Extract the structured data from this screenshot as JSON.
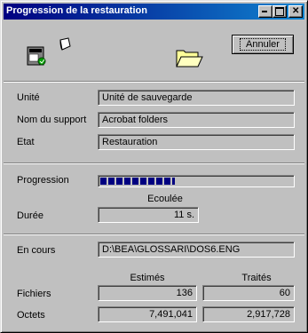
{
  "window": {
    "title": "Progression de la restauration",
    "cancel_label": "Annuler"
  },
  "info": {
    "unite_label": "Unité",
    "unite_value": "Unité de sauvegarde",
    "support_label": "Nom du support",
    "support_value": "Acrobat folders",
    "etat_label": "Etat",
    "etat_value": "Restauration"
  },
  "progress": {
    "label": "Progression",
    "fraction": 0.39,
    "elapsed_header": "Ecoulée",
    "duration_label": "Durée",
    "duration_value": "11 s."
  },
  "current": {
    "label": "En cours",
    "path": "D:\\BEA\\GLOSSARI\\DOS6.ENG",
    "estimated_header": "Estimés",
    "processed_header": "Traités",
    "files_label": "Fichiers",
    "files_estimated": "136",
    "files_processed": "60",
    "bytes_label": "Octets",
    "bytes_estimated": "7,491,041",
    "bytes_processed": "2,917,728"
  },
  "icons": [
    "tape-drive-icon",
    "flying-page-icon",
    "open-folder-icon",
    "minimize-icon",
    "maximize-icon",
    "close-icon"
  ],
  "colors": {
    "titlebar_start": "#000080",
    "titlebar_end": "#1084d0",
    "progress_block": "#000080",
    "dialog_face": "#c0c0c0"
  }
}
